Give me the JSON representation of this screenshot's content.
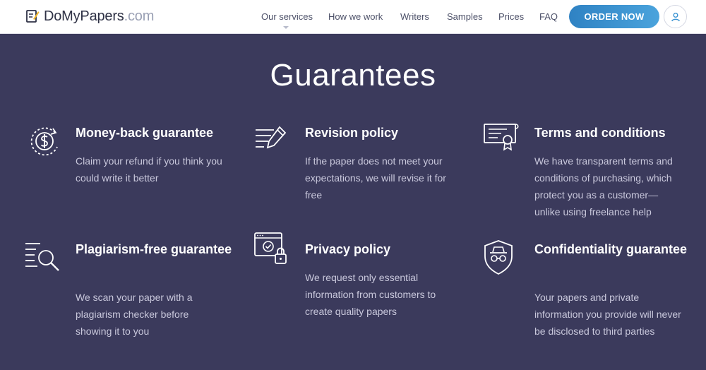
{
  "header": {
    "logo_main": "DoMyPapers",
    "logo_domain": ".com",
    "nav": [
      "Our services",
      "How we work",
      "Writers",
      "Samples",
      "Prices",
      "FAQ"
    ],
    "order_label": "ORDER NOW",
    "user_icon": "user-icon"
  },
  "page_title": "Guarantees",
  "cards": [
    {
      "title": "Money-back guarantee",
      "text": "Claim your refund if you think you could write it better",
      "icon": "money-back-icon"
    },
    {
      "title": "Revision policy",
      "text": "If the paper does not meet your expectations, we will revise it for free",
      "icon": "revision-icon"
    },
    {
      "title": "Terms and conditions",
      "text": "We have transparent terms and conditions of purchasing, which protect you as a customer—unlike using freelance help",
      "icon": "certificate-icon"
    },
    {
      "title": "Plagiarism-free guarantee",
      "text": "We scan your paper with a plagiarism checker before showing it to you",
      "icon": "plagiarism-search-icon"
    },
    {
      "title": "Privacy policy",
      "text": "We request only essential information from customers to create quality papers",
      "icon": "privacy-lock-icon"
    },
    {
      "title": "Confidentiality guarantee",
      "text": "Your papers and private information you provide will never be disclosed to third parties",
      "icon": "incognito-shield-icon"
    }
  ],
  "colors": {
    "background": "#3b3a5c",
    "accent": "#3a93d2",
    "header_bg": "#ffffff"
  }
}
